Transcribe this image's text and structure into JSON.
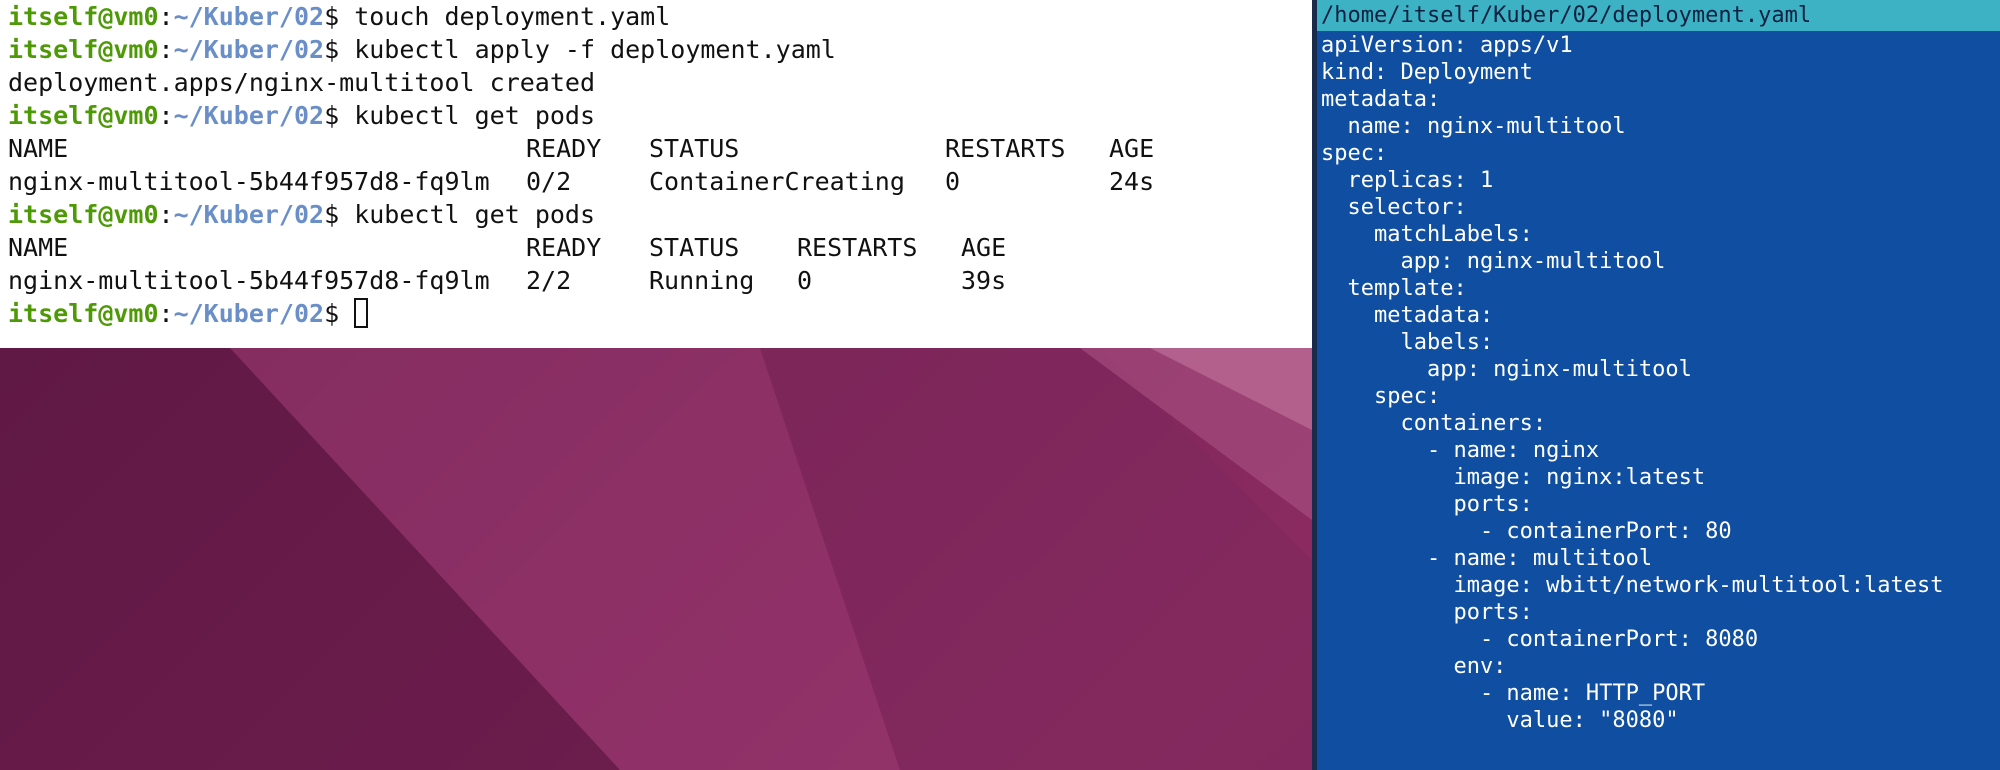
{
  "terminal": {
    "lines": [
      {
        "type": "prompt",
        "user": "itself@vm0",
        "path": "~/Kuber/02",
        "command": "touch deployment.yaml"
      },
      {
        "type": "prompt",
        "user": "itself@vm0",
        "path": "~/Kuber/02",
        "command": "kubectl apply -f deployment.yaml"
      },
      {
        "type": "output",
        "text": "deployment.apps/nginx-multitool created"
      },
      {
        "type": "prompt",
        "user": "itself@vm0",
        "path": "~/Kuber/02",
        "command": "kubectl get pods"
      },
      {
        "type": "table1_header",
        "cells": [
          "NAME",
          "READY",
          "STATUS",
          "RESTARTS",
          "AGE"
        ]
      },
      {
        "type": "table1_row",
        "cells": [
          "nginx-multitool-5b44f957d8-fq9lm",
          "0/2",
          "ContainerCreating",
          "0",
          "24s"
        ]
      },
      {
        "type": "prompt",
        "user": "itself@vm0",
        "path": "~/Kuber/02",
        "command": "kubectl get pods"
      },
      {
        "type": "table2_header",
        "cells": [
          "NAME",
          "READY",
          "STATUS",
          "RESTARTS",
          "AGE"
        ]
      },
      {
        "type": "table2_row",
        "cells": [
          "nginx-multitool-5b44f957d8-fq9lm",
          "2/2",
          "Running",
          "0",
          "39s"
        ]
      },
      {
        "type": "prompt_cursor",
        "user": "itself@vm0",
        "path": "~/Kuber/02",
        "command": ""
      }
    ]
  },
  "editor": {
    "title": "/home/itself/Kuber/02/deployment.yaml",
    "lines": [
      "apiVersion: apps/v1",
      "kind: Deployment",
      "metadata:",
      "  name: nginx-multitool",
      "spec:",
      "  replicas: 1",
      "  selector:",
      "    matchLabels:",
      "      app: nginx-multitool",
      "  template:",
      "    metadata:",
      "      labels:",
      "        app: nginx-multitool",
      "    spec:",
      "      containers:",
      "        - name: nginx",
      "          image: nginx:latest",
      "          ports:",
      "            - containerPort: 80",
      "        - name: multitool",
      "          image: wbitt/network-multitool:latest",
      "          ports:",
      "            - containerPort: 8080",
      "          env:",
      "            - name: HTTP_PORT",
      "              value: \"8080\""
    ]
  },
  "colors": {
    "prompt_user": "#4e9a06",
    "prompt_path": "#6a8fc8",
    "editor_bg": "#0f4ea0",
    "editor_title_bg": "#3db2c4"
  }
}
